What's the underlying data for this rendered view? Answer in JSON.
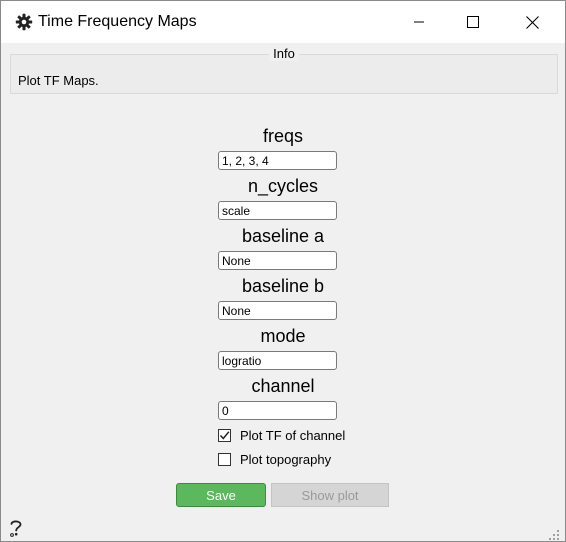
{
  "window": {
    "title": "Time Frequency Maps",
    "icon": "gear-icon"
  },
  "info": {
    "title": "Info",
    "text": "Plot TF Maps."
  },
  "fields": [
    {
      "label": "freqs",
      "value": "1, 2, 3, 4"
    },
    {
      "label": "n_cycles",
      "value": "scale"
    },
    {
      "label": "baseline a",
      "value": "None"
    },
    {
      "label": "baseline b",
      "value": "None"
    },
    {
      "label": "mode",
      "value": "logratio"
    },
    {
      "label": "channel",
      "value": "0"
    }
  ],
  "checkboxes": [
    {
      "label": "Plot TF of channel",
      "checked": true
    },
    {
      "label": "Plot topography",
      "checked": false
    }
  ],
  "buttons": {
    "save": "Save",
    "show_plot": "Show plot"
  },
  "colors": {
    "save_button": "#5cb85c",
    "disabled_button": "#d5d5d5"
  }
}
